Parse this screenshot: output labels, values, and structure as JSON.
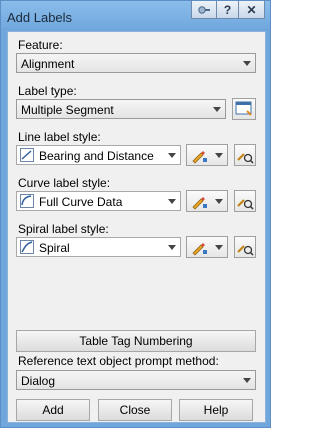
{
  "window": {
    "title": "Add Labels"
  },
  "feature": {
    "label": "Feature:",
    "value": "Alignment"
  },
  "label_type": {
    "label": "Label type:",
    "value": "Multiple Segment"
  },
  "line_style": {
    "label": "Line label style:",
    "value": "Bearing and Distance"
  },
  "curve_style": {
    "label": "Curve label style:",
    "value": "Full Curve Data"
  },
  "spiral_style": {
    "label": "Spiral label style:",
    "value": "Spiral"
  },
  "table_tag_button": "Table Tag Numbering",
  "reference": {
    "label": "Reference text object prompt method:",
    "value": "Dialog"
  },
  "buttons": {
    "add": "Add",
    "close": "Close",
    "help": "Help"
  },
  "titlebar_buttons": {
    "help_glyph": "?",
    "close_glyph": "✕"
  },
  "icons": {
    "pin": "pin-icon",
    "style_edit": "pencil-style-edit-icon",
    "style_browse": "magnify-style-browse-icon",
    "label_type_browse": "browse-window-icon"
  }
}
